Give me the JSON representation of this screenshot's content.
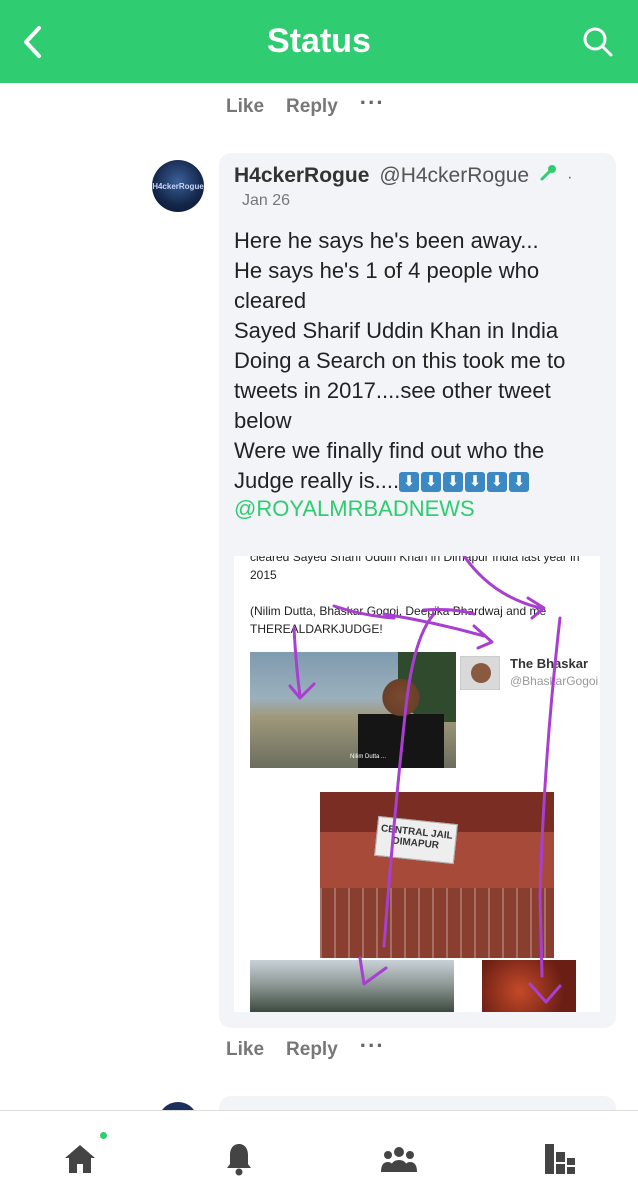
{
  "header": {
    "title": "Status",
    "back_icon": "chevron-left-icon",
    "search_icon": "search-icon",
    "accent": "#2fcc71"
  },
  "top_actions": {
    "like": "Like",
    "reply": "Reply",
    "more": "···"
  },
  "post": {
    "author_name": "H4ckerRogue",
    "author_handle": "@H4ckerRogue",
    "avatar_text": "H4ckerRogue",
    "date": "Jan 26",
    "lines": [
      "Here he says he's been away...",
      "He says he's 1 of 4 people who",
      "cleared",
      "Sayed Sharif Uddin Khan in India",
      "Doing a Search on this took me to",
      "tweets in 2017....see other tweet",
      "below",
      "Were we finally find out who the",
      "Judge really is...."
    ],
    "arrows": [
      "⬇",
      "⬇",
      "⬇",
      "⬇",
      "⬇",
      "⬇"
    ],
    "mention": "@ROYALMRBADNEWS",
    "media": {
      "line1": "cleared Sayed Sharif Uddin Khan in Dimapur India last year in",
      "line2": "2015",
      "line3": "(Nilim Dutta, Bhaskar Gogoi, Deepika Bhardwaj and me",
      "line4": "THEREALDARKJUDGE!",
      "profile_name": "The Bhaskar",
      "profile_handle": "@BhaskarGogoi",
      "caption": "Nilim Dutta ...",
      "sign": "CENTRAL JAIL DIMAPUR"
    }
  },
  "bottom_actions": {
    "like": "Like",
    "reply": "Reply",
    "more": "···"
  },
  "nav": [
    {
      "name": "home",
      "icon": "home-icon"
    },
    {
      "name": "notifications",
      "icon": "bell-icon"
    },
    {
      "name": "groups",
      "icon": "people-icon"
    },
    {
      "name": "trends",
      "icon": "bars-icon"
    }
  ]
}
